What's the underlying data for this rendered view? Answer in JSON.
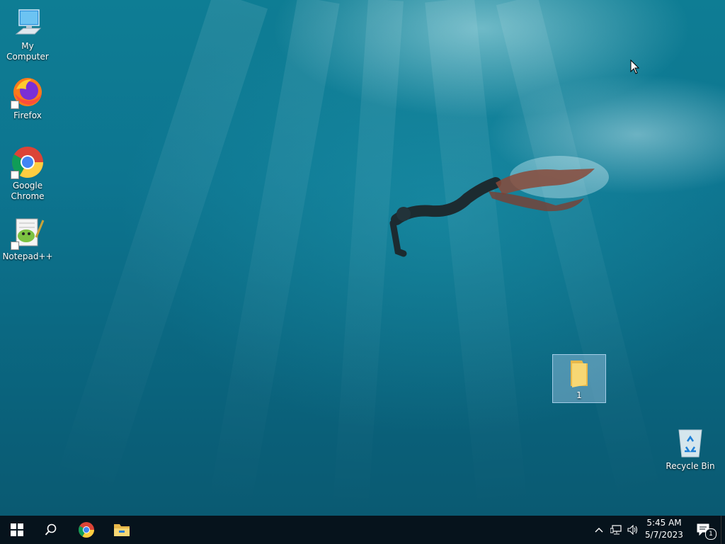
{
  "desktop": {
    "icons": [
      {
        "label": "My Computer",
        "icon": "computer-icon"
      },
      {
        "label": "Firefox",
        "icon": "firefox-icon"
      },
      {
        "label": "Google Chrome",
        "icon": "chrome-icon"
      },
      {
        "label": "Notepad++",
        "icon": "notepadpp-icon"
      },
      {
        "label": "1",
        "icon": "folder-icon"
      },
      {
        "label": "Recycle Bin",
        "icon": "recycle-bin-icon"
      }
    ]
  },
  "taskbar": {
    "start_icon": "windows-logo-icon",
    "search_icon": "search-icon",
    "pinned": [
      "chrome-icon",
      "file-explorer-icon"
    ],
    "tray": {
      "time": "5:45 AM",
      "date": "5/7/2023",
      "notification_count": "1"
    }
  },
  "colors": {
    "taskbar": "#06131c",
    "water": "#0d7590"
  }
}
